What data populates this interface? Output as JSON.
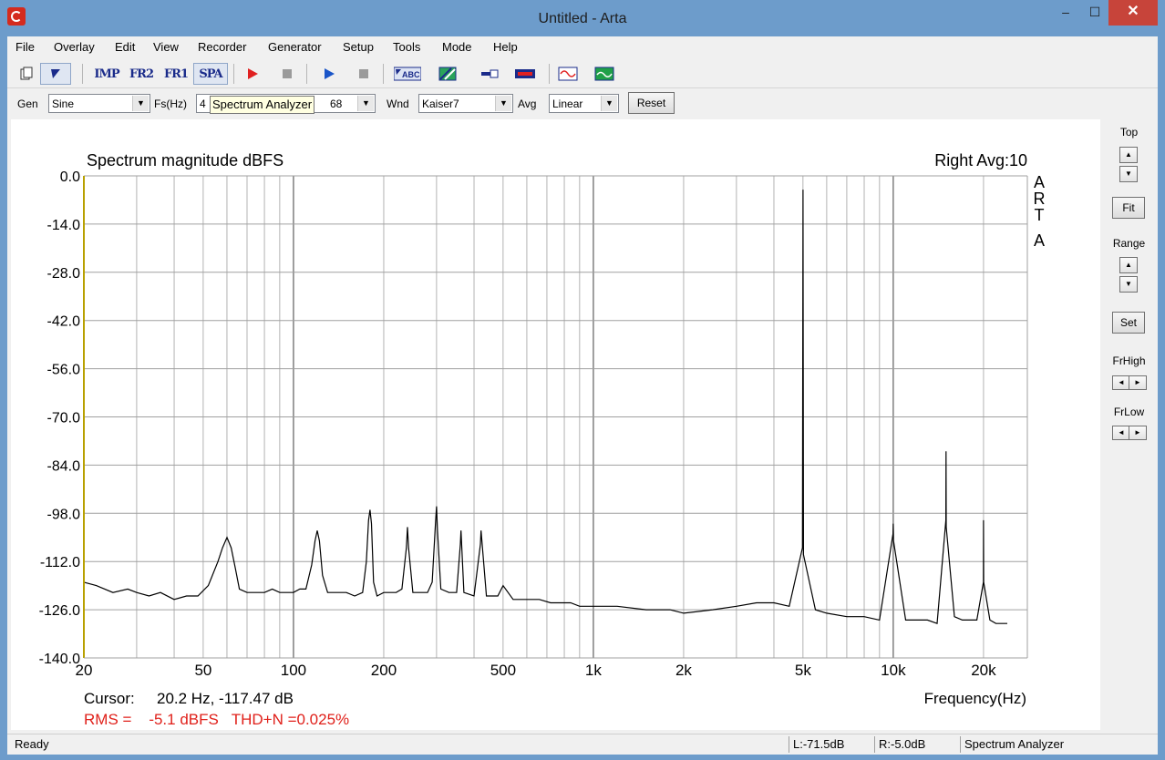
{
  "window": {
    "title": "Untitled - Arta",
    "min_glyph": "–",
    "max_glyph": "☐",
    "close_glyph": "✕"
  },
  "menu": [
    "File",
    "Overlay",
    "Edit",
    "View",
    "Recorder",
    "Generator",
    "Setup",
    "Tools",
    "Mode",
    "Help"
  ],
  "toolbar": {
    "imp": "IMP",
    "fr2": "FR2",
    "fr1": "FR1",
    "spa": "SPA",
    "abc": "ABC",
    "icons": [
      "new-document-icon",
      "pointer-icon",
      "record-icon",
      "stop-icon",
      "play-icon",
      "stop-icon",
      "abc-icon",
      "hatch-icon",
      "probe-icon",
      "meter-icon",
      "sine-icon",
      "scope-icon"
    ]
  },
  "controls": {
    "gen_label": "Gen",
    "gen_value": "Sine",
    "fs_label": "Fs(Hz)",
    "fs_value_prefix": "4",
    "fs_value_suffix": "68",
    "wnd_label": "Wnd",
    "wnd_value": "Kaiser7",
    "avg_label": "Avg",
    "avg_value": "Linear",
    "reset_label": "Reset",
    "tooltip": "Spectrum Analyzer"
  },
  "side_panel": {
    "top_label": "Top",
    "fit_label": "Fit",
    "range_label": "Range",
    "set_label": "Set",
    "frhigh_label": "FrHigh",
    "frlow_label": "FrLow"
  },
  "plot": {
    "title": "Spectrum magnitude dBFS",
    "channel_info": "Right  Avg:10",
    "logo": [
      "A",
      "R",
      "T",
      "A"
    ],
    "xlabel": "Frequency(Hz)",
    "cursor_label": "Cursor:",
    "cursor_value": "20.2 Hz, -117.47 dB",
    "rms_text": "RMS =    -5.1 dBFS   THD+N =0.025%",
    "colors": {
      "trace": "#000000",
      "grid": "#a0a0a0",
      "axis": "#b8a000",
      "rms": "#e0201a"
    }
  },
  "chart_data": {
    "type": "line",
    "title": "Spectrum magnitude dBFS",
    "xlabel": "Frequency(Hz)",
    "ylabel": "",
    "x_scale": "log",
    "xlim": [
      20,
      28000
    ],
    "ylim": [
      -140,
      0
    ],
    "x_ticks": [
      20,
      50,
      100,
      200,
      500,
      1000,
      2000,
      5000,
      10000,
      20000
    ],
    "x_tick_labels": [
      "20",
      "50",
      "100",
      "200",
      "500",
      "1k",
      "2k",
      "5k",
      "10k",
      "20k"
    ],
    "y_ticks": [
      0.0,
      -14.0,
      -28.0,
      -42.0,
      -56.0,
      -70.0,
      -84.0,
      -98.0,
      -112.0,
      -126.0,
      -140.0
    ],
    "y_tick_labels": [
      "0.0",
      "-14.0",
      "-28.0",
      "-42.0",
      "-56.0",
      "-70.0",
      "-84.0",
      "-98.0",
      "-112.0",
      "-126.0",
      "-140.0"
    ],
    "grid": true,
    "series": [
      {
        "x": [
          20,
          22,
          25,
          28,
          30,
          33,
          36,
          40,
          44,
          48,
          52,
          56,
          58,
          60,
          62,
          64,
          66,
          70,
          75,
          80,
          85,
          90,
          95,
          100,
          105,
          110,
          115,
          118,
          120,
          122,
          125,
          130,
          140,
          150,
          160,
          170,
          175,
          178,
          180,
          182,
          185,
          190,
          200,
          210,
          220,
          230,
          238,
          240,
          242,
          250,
          260,
          280,
          290,
          298,
          300,
          302,
          310,
          330,
          350,
          360,
          362,
          370,
          400,
          420,
          422,
          440,
          480,
          500,
          540,
          600,
          660,
          720,
          780,
          840,
          900,
          960,
          1000,
          1200,
          1500,
          1800,
          2000,
          2500,
          3000,
          3500,
          4000,
          4500,
          4980,
          5000,
          5020,
          5500,
          6000,
          7000,
          8000,
          9000,
          9980,
          10000,
          10020,
          11000,
          12000,
          13000,
          14000,
          14980,
          15000,
          15020,
          16000,
          17000,
          18000,
          19000,
          19980,
          20000,
          20020,
          21000,
          22000,
          23000,
          24000
        ],
        "y": [
          -118,
          -119,
          -121,
          -120,
          -121,
          -122,
          -121,
          -123,
          -122,
          -122,
          -119,
          -112,
          -108,
          -105,
          -108,
          -114,
          -120,
          -121,
          -121,
          -121,
          -120,
          -121,
          -121,
          -121,
          -120,
          -120,
          -113,
          -106,
          -103,
          -106,
          -116,
          -121,
          -121,
          -121,
          -122,
          -121,
          -112,
          -100,
          -97,
          -101,
          -118,
          -122,
          -121,
          -121,
          -121,
          -120,
          -108,
          -102,
          -108,
          -121,
          -121,
          -121,
          -118,
          -100,
          -96,
          -103,
          -120,
          -121,
          -121,
          -107,
          -103,
          -121,
          -122,
          -107,
          -103,
          -122,
          -122,
          -119,
          -123,
          -123,
          -123,
          -124,
          -124,
          -124,
          -125,
          -125,
          -125,
          -125,
          -126,
          -126,
          -127,
          -126,
          -125,
          -124,
          -124,
          -125,
          -108,
          -4,
          -110,
          -126,
          -127,
          -128,
          -128,
          -129,
          -104,
          -101,
          -106,
          -129,
          -129,
          -129,
          -130,
          -100,
          -80,
          -102,
          -128,
          -129,
          -129,
          -129,
          -118,
          -100,
          -118,
          -129,
          -130,
          -130,
          -130
        ]
      }
    ]
  },
  "statusbar": {
    "ready": "Ready",
    "left_level": "L:-71.5dB",
    "right_level": "R:-5.0dB",
    "mode": "Spectrum Analyzer"
  }
}
